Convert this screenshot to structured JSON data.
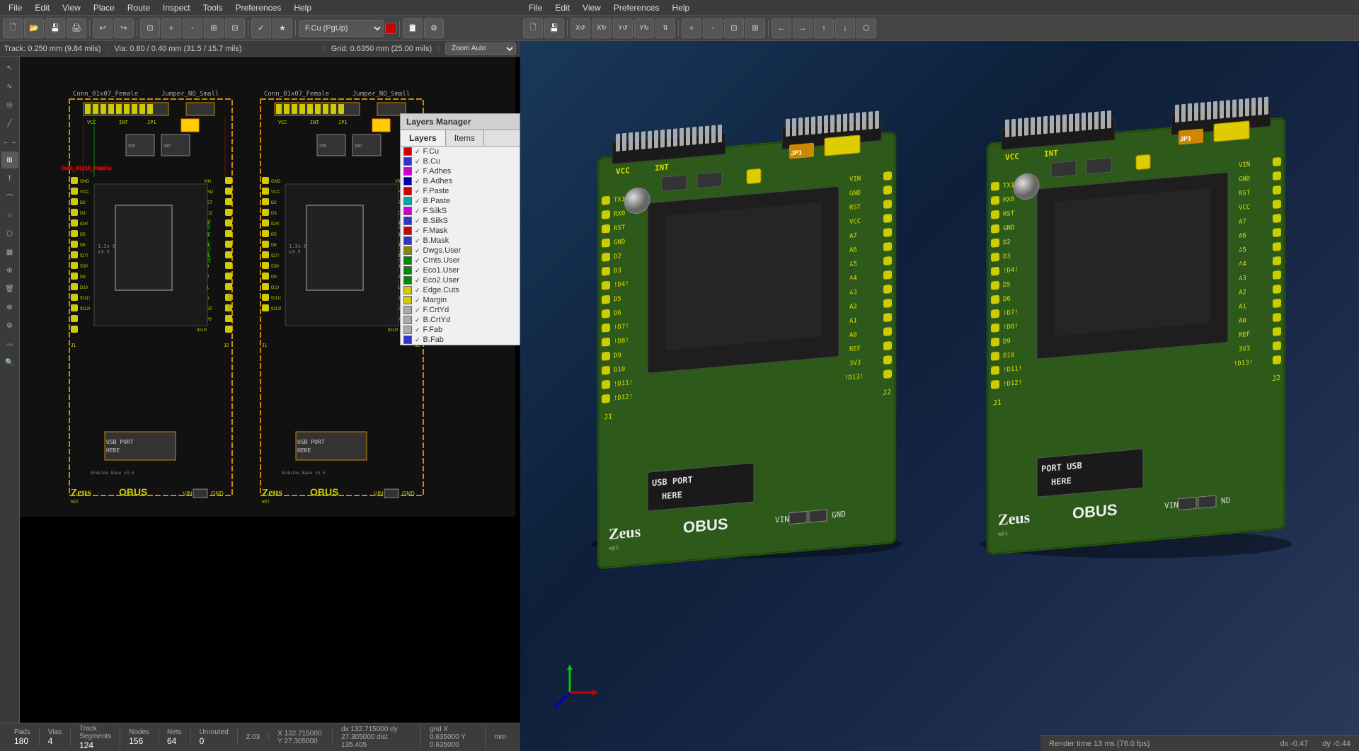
{
  "left_menu": {
    "items": [
      "File",
      "Edit",
      "View",
      "Place",
      "Route",
      "Inspect",
      "Tools",
      "Preferences",
      "Help"
    ]
  },
  "right_menu": {
    "items": [
      "File",
      "Edit",
      "View",
      "Preferences",
      "Help"
    ]
  },
  "left_toolbar": {
    "track_label": "Track: 0.250 mm (9.84 mils)",
    "via_label": "Via: 0.80 / 0.40 mm (31.5 / 15.7 mils)",
    "grid_label": "Grid: 0.6350 mm (25.00 mils)",
    "zoom_label": "Zoom Auto",
    "layer_label": "F.Cu (PgUp)"
  },
  "layers_panel": {
    "title": "Layers Manager",
    "tab_layers": "Layers",
    "tab_items": "Items",
    "layers": [
      {
        "name": "F.Cu",
        "color": "#cc0000",
        "visible": true
      },
      {
        "name": "B.Cu",
        "color": "#3333cc",
        "visible": true
      },
      {
        "name": "F.Adhes",
        "color": "#cc00cc",
        "visible": true
      },
      {
        "name": "B.Adhes",
        "color": "#0000aa",
        "visible": true
      },
      {
        "name": "F.Paste",
        "color": "#cc0000",
        "visible": true
      },
      {
        "name": "B.Paste",
        "color": "#00aaaa",
        "visible": true
      },
      {
        "name": "F.SilkS",
        "color": "#cc00cc",
        "visible": true
      },
      {
        "name": "B.SilkS",
        "color": "#3333cc",
        "visible": true
      },
      {
        "name": "F.Mask",
        "color": "#cc0000",
        "visible": true
      },
      {
        "name": "B.Mask",
        "color": "#3333cc",
        "visible": true
      },
      {
        "name": "Dwgs.User",
        "color": "#888800",
        "visible": true
      },
      {
        "name": "Cmts.User",
        "color": "#008800",
        "visible": true
      },
      {
        "name": "Eco1.User",
        "color": "#008800",
        "visible": true
      },
      {
        "name": "Eco2.User",
        "color": "#008800",
        "visible": true
      },
      {
        "name": "Edge.Cuts",
        "color": "#cccc00",
        "visible": true
      },
      {
        "name": "Margin",
        "color": "#cccc00",
        "visible": true
      },
      {
        "name": "F.CrtYd",
        "color": "#aaaaaa",
        "visible": true
      },
      {
        "name": "B.CrtYd",
        "color": "#aaaaaa",
        "visible": true
      },
      {
        "name": "F.Fab",
        "color": "#aaaaaa",
        "visible": true
      },
      {
        "name": "B.Fab",
        "color": "#3333cc",
        "visible": true
      }
    ]
  },
  "status_bar": {
    "pads_label": "Pads",
    "pads_value": "180",
    "vias_label": "Vias",
    "vias_value": "4",
    "track_label": "Track Segments",
    "track_value": "124",
    "nodes_label": "Nodes",
    "nodes_value": "156",
    "nets_label": "Nets",
    "nets_value": "64",
    "unrouted_label": "Unrouted",
    "unrouted_value": "0"
  },
  "coord_bar": {
    "zoom": "2.03",
    "x": "X 132.715000  Y 27.305000",
    "dx": "dx 132.715000  dy 27.305000  dist 135.405",
    "grid": "grid X 0.635000  Y 0.635000",
    "unit": "mm"
  },
  "right_status": {
    "render_time": "Render time 13 ms (76.0 fps)",
    "dx": "dx -0.47",
    "dy": "dy -0.44"
  },
  "pcb_labels": {
    "usb_port_here_1": "USB PORT HERE",
    "usb_port_here_2": "PORT USB HERE",
    "obus_1": "OBUS",
    "obus_2": "OBUS",
    "zeus_1": "Zeus",
    "zeus_2": "Zeus"
  }
}
